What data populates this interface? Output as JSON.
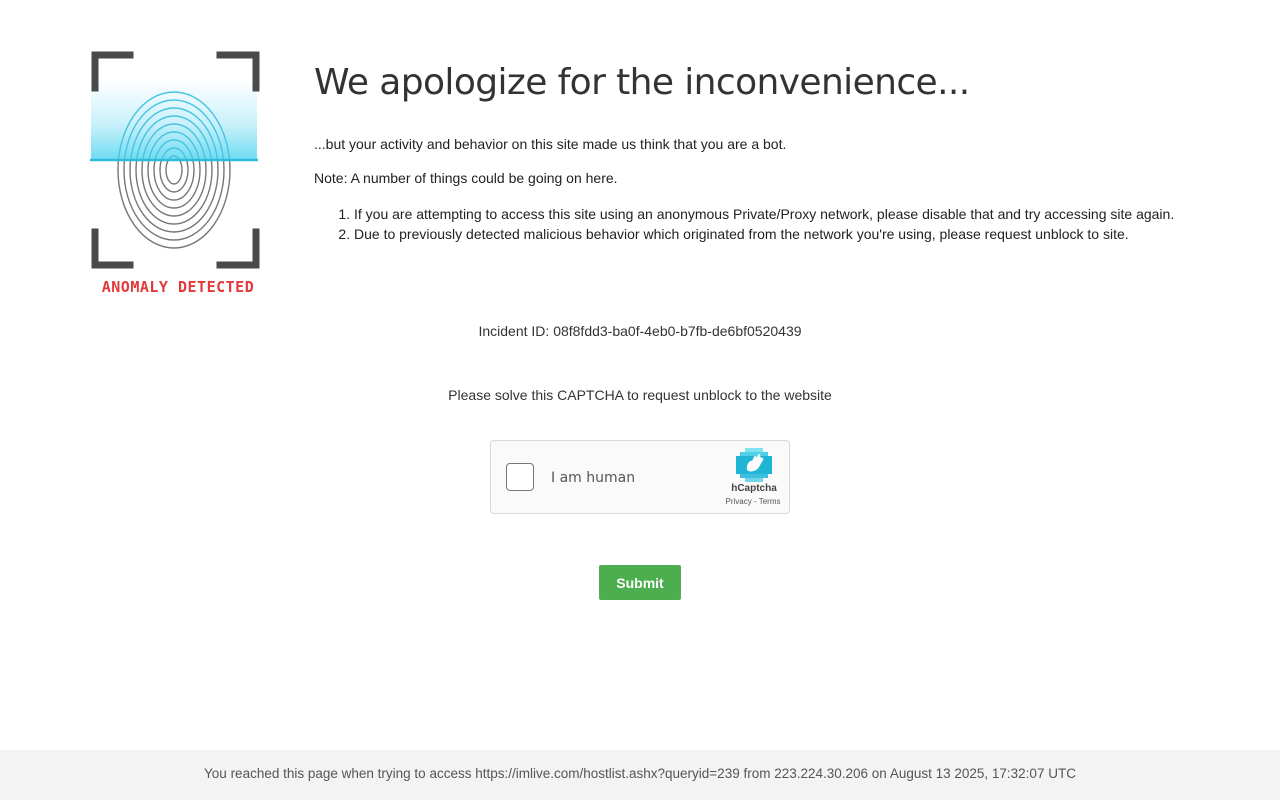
{
  "logo": {
    "caption": "ANOMALY DETECTED",
    "icon": "fingerprint-icon",
    "caption_color": "#e23a3a"
  },
  "headline": "We apologize for the inconvenience...",
  "paragraph1": "...but your activity and behavior on this site made us think that you are a bot.",
  "paragraph2": "Note: A number of things could be going on here.",
  "reasons": [
    "If you are attempting to access this site using an anonymous Private/Proxy network, please disable that and try accessing site again.",
    "Due to previously detected malicious behavior which originated from the network you're using, please request unblock to site."
  ],
  "incident": "Incident ID: 08f8fdd3-ba0f-4eb0-b7fb-de6bf0520439",
  "captcha_prompt": "Please solve this CAPTCHA to request unblock to the website",
  "hcaptcha": {
    "checkbox_label": "I am human",
    "brand": "hCaptcha",
    "privacy": "Privacy",
    "separator": " - ",
    "terms": "Terms",
    "icon": "hcaptcha-logo-icon"
  },
  "submit_label": "Submit",
  "submit_color": "#4cae4f",
  "footer": "You reached this page when trying to access https://imlive.com/hostlist.ashx?queryid=239 from 223.224.30.206 on August 13 2025, 17:32:07 UTC"
}
